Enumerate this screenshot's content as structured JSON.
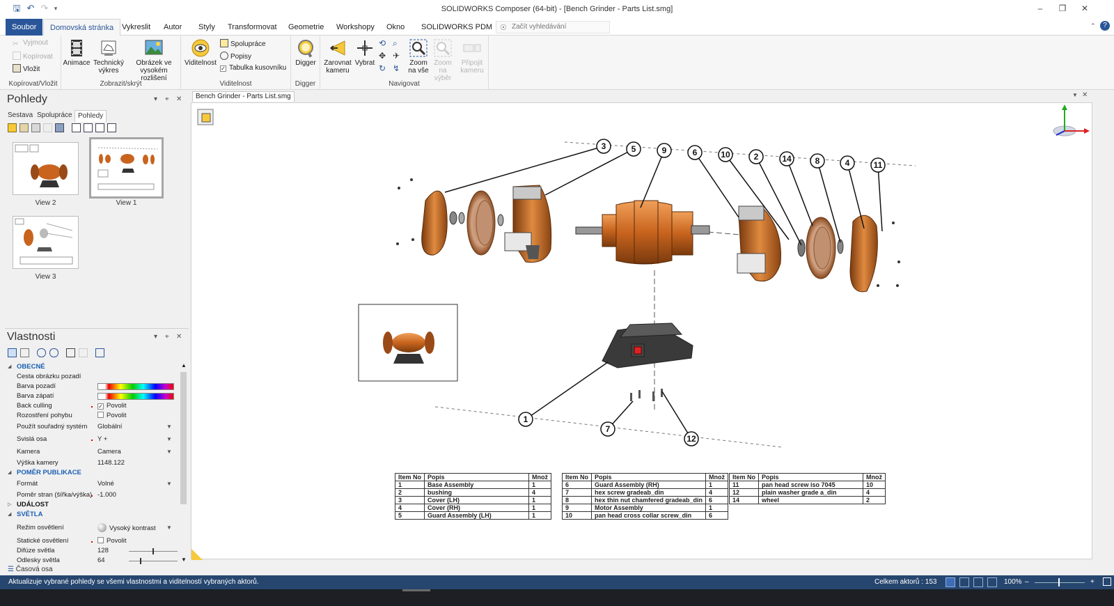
{
  "window": {
    "title": "SOLIDWORKS Composer (64-bit) - [Bench Grinder - Parts List.smg]"
  },
  "menu": {
    "file": "Soubor",
    "tabs": [
      "Domovská stránka",
      "Vykreslit",
      "Autor",
      "Styly",
      "Transformovat",
      "Geometrie",
      "Workshopy",
      "Okno",
      "SOLIDWORKS PDM"
    ],
    "search_placeholder": "Začít vyhledávání"
  },
  "ribbon": {
    "clipboard": {
      "cut": "Vyjmout",
      "copy": "Kopírovat",
      "paste": "Vložit",
      "group": "Kopírovat/Vložit"
    },
    "show_hide": {
      "animation": "Animace",
      "tech_drawing": "Technický výkres",
      "hires_image": "Obrázek ve vysokém rozlišení",
      "group": "Zobrazit/skrýt"
    },
    "visibility": {
      "visibility": "Viditelnost",
      "collaboration": "Spolupráce",
      "labels": "Popisy",
      "bom_table": "Tabulka kusovníku",
      "group": "Viditelnost"
    },
    "digger": {
      "digger": "Digger",
      "group": "Digger"
    },
    "navigate": {
      "align_camera": "Zarovnat kameru",
      "select": "Vybrat",
      "zoom_all": "Zoom na vše",
      "zoom_selection": "Zoom na výběr",
      "attach_camera": "Připojit kameru",
      "group": "Navigovat"
    }
  },
  "views_panel": {
    "title": "Pohledy",
    "tabs": [
      "Sestava",
      "Spolupráce",
      "Pohledy"
    ],
    "views": [
      "View 2",
      "View 1",
      "View 3"
    ]
  },
  "properties_panel": {
    "title": "Vlastnosti",
    "rows": {
      "general": "OBECNÉ",
      "bg_image_path": "Cesta obrázku pozadí",
      "bg_color": "Barva pozadí",
      "footer_color": "Barva zápatí",
      "back_culling": "Back culling",
      "back_culling_val": "Povolit",
      "motion_blur": "Rozostření pohybu",
      "motion_blur_val": "Povolit",
      "coord_system": "Použít souřadný systém",
      "coord_system_val": "Globální",
      "vertical_axis": "Svislá osa",
      "vertical_axis_val": "Y +",
      "camera": "Kamera",
      "camera_val": "Camera",
      "camera_height": "Výška kamery",
      "camera_height_val": "1148.122",
      "pub_ratio": "POMĚR PUBLIKACE",
      "format": "Formát",
      "format_val": "Volné",
      "aspect": "Poměr stran (šířka/výška)",
      "aspect_val": "-1.000",
      "events": "UDÁLOST",
      "lights": "SVĚTLA",
      "light_mode": "Režim osvětlení",
      "light_mode_val": "Vysoký kontrast",
      "static_light": "Statické osvětlení",
      "static_light_val": "Povolit",
      "diffuse": "Difúze světla",
      "diffuse_val": "128",
      "specular": "Odlesky světla",
      "specular_val": "64"
    },
    "timeline": "Časová osa"
  },
  "document": {
    "tab": "Bench Grinder - Parts List.smg"
  },
  "balloons": [
    "3",
    "5",
    "9",
    "6",
    "10",
    "2",
    "14",
    "8",
    "4",
    "11",
    "1",
    "7",
    "12"
  ],
  "bom": {
    "headers": [
      "Item No",
      "Popis",
      "Množ"
    ],
    "table1": [
      [
        "1",
        "Base Assembly",
        "1"
      ],
      [
        "2",
        "bushing",
        "4"
      ],
      [
        "3",
        "Cover (LH)",
        "1"
      ],
      [
        "4",
        "Cover (RH)",
        "1"
      ],
      [
        "5",
        "Guard Assembly (LH)",
        "1"
      ]
    ],
    "table2": [
      [
        "6",
        "Guard Assembly (RH)",
        "1"
      ],
      [
        "7",
        "hex screw gradeab_din",
        "4"
      ],
      [
        "8",
        "hex thin nut chamfered gradeab_din",
        "6"
      ],
      [
        "9",
        "Motor Assembly",
        "1"
      ],
      [
        "10",
        "pan head cross collar screw_din",
        "6"
      ]
    ],
    "table3": [
      [
        "11",
        "pan head screw iso 7045",
        "10"
      ],
      [
        "12",
        "plain washer grade a_din",
        "4"
      ],
      [
        "14",
        "wheel",
        "2"
      ]
    ]
  },
  "status": {
    "message": "Aktualizuje vybrané pohledy se všemi vlastnostmi a viditelností vybraných aktorů.",
    "actors": "Celkem aktorů : 153",
    "zoom": "100%"
  },
  "colors": {
    "accent": "#2a5699",
    "status_bg": "#26466f",
    "copper": "#c8641e"
  }
}
